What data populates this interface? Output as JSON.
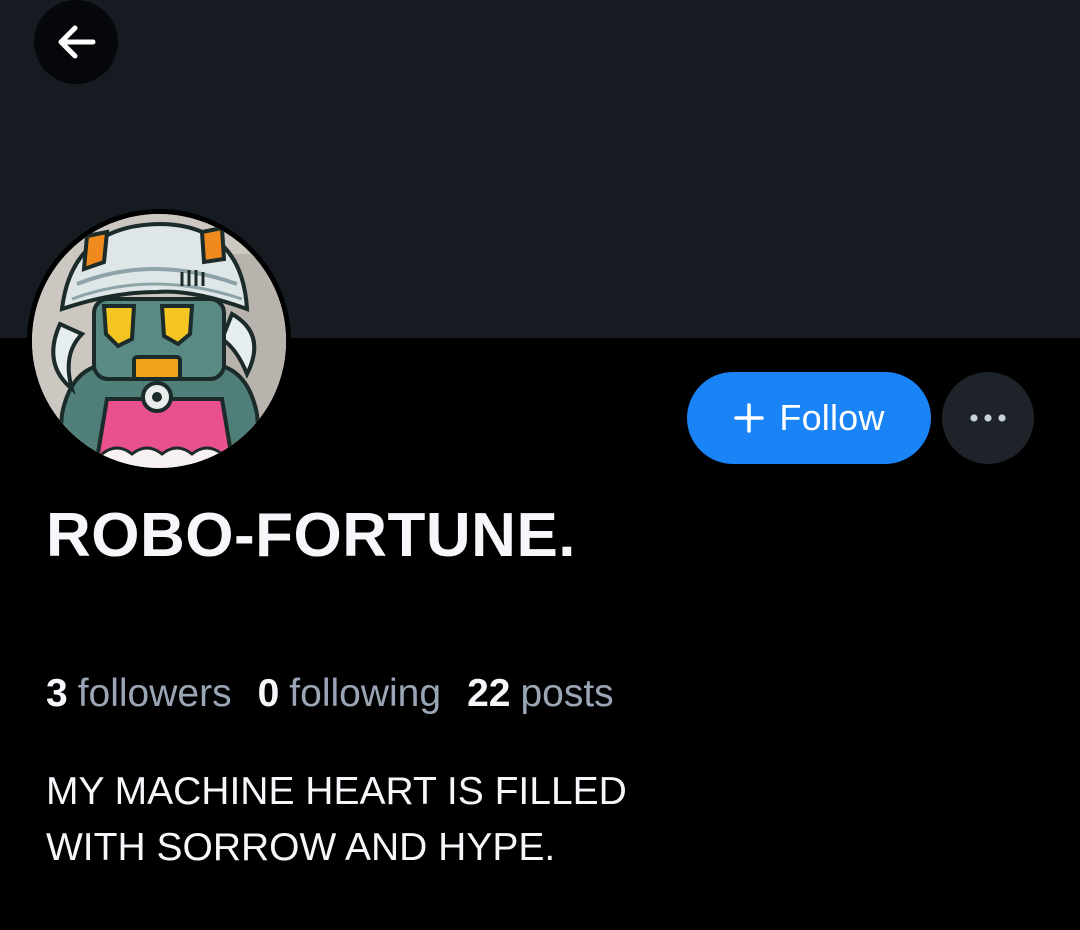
{
  "profile": {
    "display_name": "ROBO-FORTUNE.",
    "bio_lines": [
      "MY MACHINE HEART IS FILLED",
      "WITH SORROW AND HYPE."
    ]
  },
  "stats": {
    "followers_count": "3",
    "followers_label": "followers",
    "following_count": "0",
    "following_label": "following",
    "posts_count": "22",
    "posts_label": "posts"
  },
  "actions": {
    "follow_label": "Follow",
    "follow_icon": "plus-icon",
    "more_icon": "ellipsis-icon",
    "back_icon": "arrow-left-icon"
  },
  "colors": {
    "banner": "#161b22",
    "background": "#000000",
    "accent": "#1a83f6",
    "muted_text": "#9aa6b6"
  }
}
